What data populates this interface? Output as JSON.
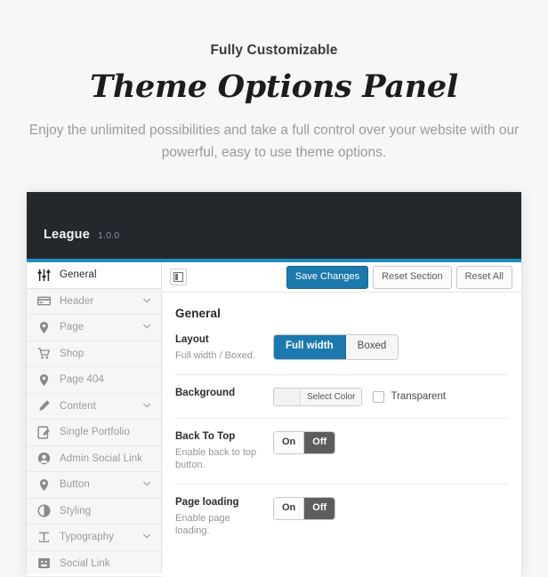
{
  "promo": {
    "kicker": "Fully Customizable",
    "title": "Theme Options Panel",
    "subtitle": "Enjoy the unlimited possibilities and take a full control over your website with our powerful, easy to use theme options."
  },
  "panel": {
    "brand_name": "League",
    "brand_version": "1.0.0",
    "accent_color": "#1e8cbe",
    "topbar_color": "#23282d",
    "primary_button_color": "#1b79ad"
  },
  "sidebar": {
    "items": [
      {
        "label": "General",
        "icon": "sliders-icon",
        "active": true,
        "chevron": false
      },
      {
        "label": "Header",
        "icon": "card-icon",
        "active": false,
        "chevron": true
      },
      {
        "label": "Page",
        "icon": "map-pin-icon",
        "active": false,
        "chevron": true
      },
      {
        "label": "Shop",
        "icon": "cart-icon",
        "active": false,
        "chevron": false
      },
      {
        "label": "Page 404",
        "icon": "map-pin-icon",
        "active": false,
        "chevron": false
      },
      {
        "label": "Content",
        "icon": "pencil-icon",
        "active": false,
        "chevron": true
      },
      {
        "label": "Single Portfolio",
        "icon": "note-edit-icon",
        "active": false,
        "chevron": false
      },
      {
        "label": "Admin Social Link",
        "icon": "user-circle-icon",
        "active": false,
        "chevron": false
      },
      {
        "label": "Button",
        "icon": "map-pin-icon",
        "active": false,
        "chevron": true
      },
      {
        "label": "Styling",
        "icon": "contrast-icon",
        "active": false,
        "chevron": false
      },
      {
        "label": "Typography",
        "icon": "text-t-icon",
        "active": false,
        "chevron": true
      },
      {
        "label": "Social Link",
        "icon": "smiley-box-icon",
        "active": false,
        "chevron": false
      }
    ]
  },
  "toolbar": {
    "expand_icon": "panel-layout-icon",
    "save_label": "Save Changes",
    "reset_section_label": "Reset Section",
    "reset_all_label": "Reset All"
  },
  "main": {
    "section_title": "General",
    "rows": [
      {
        "title": "Layout",
        "desc": "Full width / Boxed.",
        "type": "button-group",
        "options": [
          "Full width",
          "Boxed"
        ],
        "selected": "Full width"
      },
      {
        "title": "Background",
        "desc": "",
        "type": "color",
        "color_button_label": "Select Color",
        "swatch_value": "",
        "checkbox_label": "Transparent",
        "checked": false
      },
      {
        "title": "Back To Top",
        "desc": "Enable back to top button.",
        "type": "switch",
        "options": [
          "On",
          "Off"
        ],
        "selected": "Off"
      },
      {
        "title": "Page loading",
        "desc": "Enable page loading.",
        "type": "switch",
        "options": [
          "On",
          "Off"
        ],
        "selected": "Off"
      }
    ]
  }
}
